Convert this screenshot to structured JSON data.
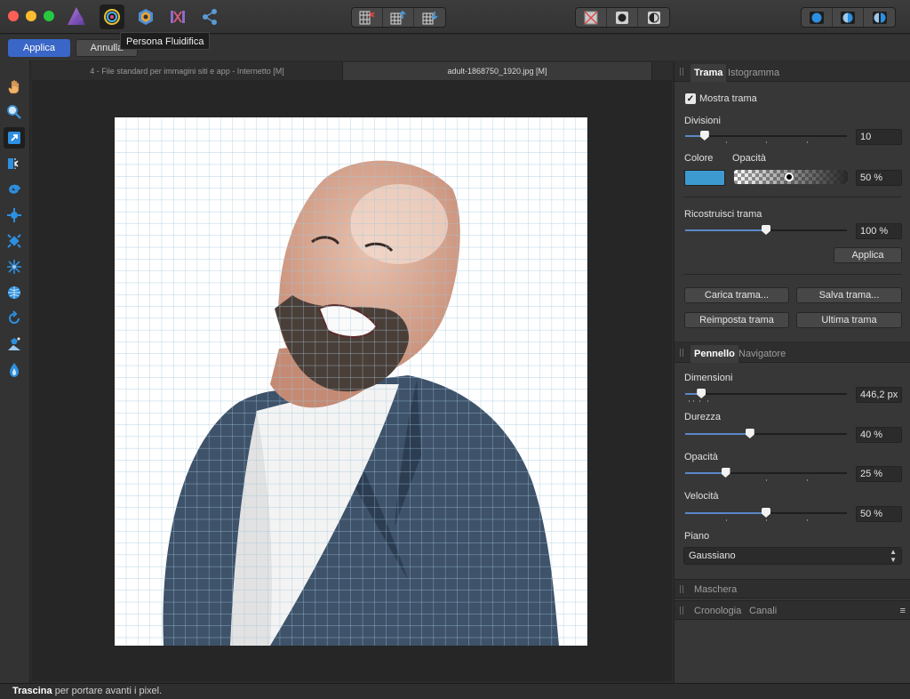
{
  "tooltip": "Persona Fluidifica",
  "context_bar": {
    "apply_label": "Applica",
    "cancel_label": "Annulla"
  },
  "document_tabs": [
    {
      "label": "4 - File standard per immagini siti e app - Internetto [M]",
      "active": false
    },
    {
      "label": "adult-1868750_1920.jpg [M]",
      "active": true
    }
  ],
  "mesh_panel": {
    "tabs": [
      "Trama",
      "Istogramma"
    ],
    "show_mesh_label": "Mostra trama",
    "show_mesh_checked": true,
    "divisions_label": "Divisioni",
    "divisions_value": "10",
    "divisions_level": 0.12,
    "color_label": "Colore",
    "opacity_label": "Opacità",
    "opacity_value": "50 %",
    "mesh_color": "#3d9ad1",
    "rebuild_label": "Ricostruisci trama",
    "rebuild_value": "100 %",
    "rebuild_level": 0.5,
    "apply_label": "Applica",
    "load_mesh": "Carica trama...",
    "save_mesh": "Salva trama...",
    "reset_mesh": "Reimposta trama",
    "last_mesh": "Ultima trama"
  },
  "brush_panel": {
    "tabs": [
      "Pennello",
      "Navigatore"
    ],
    "size_label": "Dimensioni",
    "size_value": "446,2 px",
    "size_level": 0.1,
    "hardness_label": "Durezza",
    "hardness_value": "40 %",
    "hardness_level": 0.4,
    "opacity_label": "Opacità",
    "opacity_value": "25 %",
    "opacity_level": 0.25,
    "speed_label": "Velocità",
    "speed_value": "50 %",
    "speed_level": 0.5,
    "plane_label": "Piano",
    "plane_value": "Gaussiano"
  },
  "collapsed_panels": {
    "mask": "Maschera",
    "history_tabs": [
      "Cronologia",
      "Canali"
    ]
  },
  "status": {
    "bold": "Trascina",
    "text": " per portare avanti i pixel."
  },
  "tools": [
    "hand-icon",
    "zoom-icon",
    "liquify-push-forward-icon",
    "liquify-push-left-icon",
    "twirl-icon",
    "pinch-icon",
    "punch-icon",
    "turbulence-icon",
    "mesh-clone-icon",
    "reconstruct-icon",
    "freeze-icon",
    "thaw-icon"
  ]
}
